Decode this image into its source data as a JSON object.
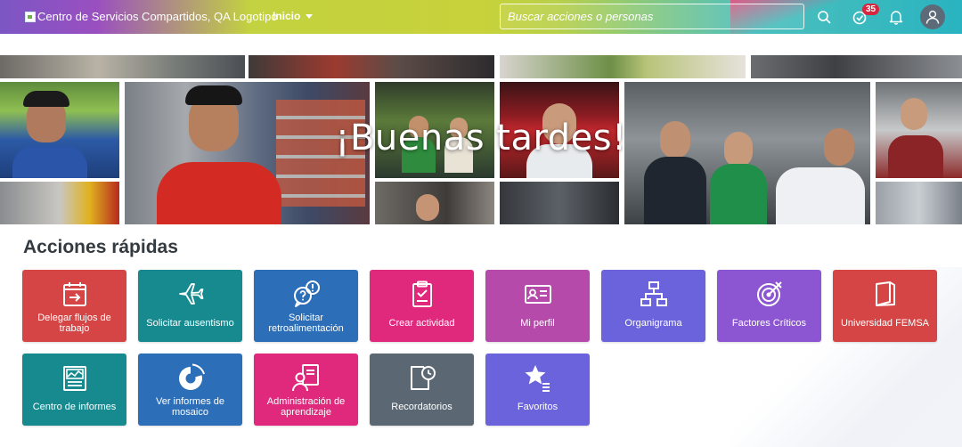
{
  "header": {
    "logo_alt": "Centro de Servicios Compartidos, QA Logotipo",
    "home_label": "Inicio",
    "search_placeholder": "Buscar acciones o personas",
    "todo_count": "35"
  },
  "banner": {
    "greeting": "¡Buenas tardes!"
  },
  "quick_actions": {
    "title": "Acciones rápidas",
    "items": [
      {
        "label": "Delegar flujos de trabajo",
        "icon": "calendar-arrow-icon",
        "color": "#d64545"
      },
      {
        "label": "Solicitar ausentismo",
        "icon": "airplane-icon",
        "color": "#168a8f"
      },
      {
        "label": "Solicitar retroalimentación",
        "icon": "chat-question-icon",
        "color": "#2c6fb8"
      },
      {
        "label": "Crear actividad",
        "icon": "clipboard-check-icon",
        "color": "#e0287d"
      },
      {
        "label": "Mi perfil",
        "icon": "id-card-icon",
        "color": "#b54aab"
      },
      {
        "label": "Organigrama",
        "icon": "org-chart-icon",
        "color": "#6b63dc"
      },
      {
        "label": "Factores Críticos",
        "icon": "target-icon",
        "color": "#8c55d2"
      },
      {
        "label": "Universidad FEMSA",
        "icon": "book-icon",
        "color": "#d64545"
      },
      {
        "label": "Centro de informes",
        "icon": "report-icon",
        "color": "#168a8f"
      },
      {
        "label": "Ver informes de mosaico",
        "icon": "pie-chart-icon",
        "color": "#2c6fb8"
      },
      {
        "label": "Administración de aprendizaje",
        "icon": "learning-icon",
        "color": "#e0287d"
      },
      {
        "label": "Recordatorios",
        "icon": "reminder-icon",
        "color": "#5b6873"
      },
      {
        "label": "Favoritos",
        "icon": "star-list-icon",
        "color": "#6b63dc"
      }
    ]
  },
  "colors": {
    "header_gradient": [
      "#7c56c4",
      "#c3d240",
      "#29b3c0"
    ],
    "badge": "#d7263d"
  }
}
